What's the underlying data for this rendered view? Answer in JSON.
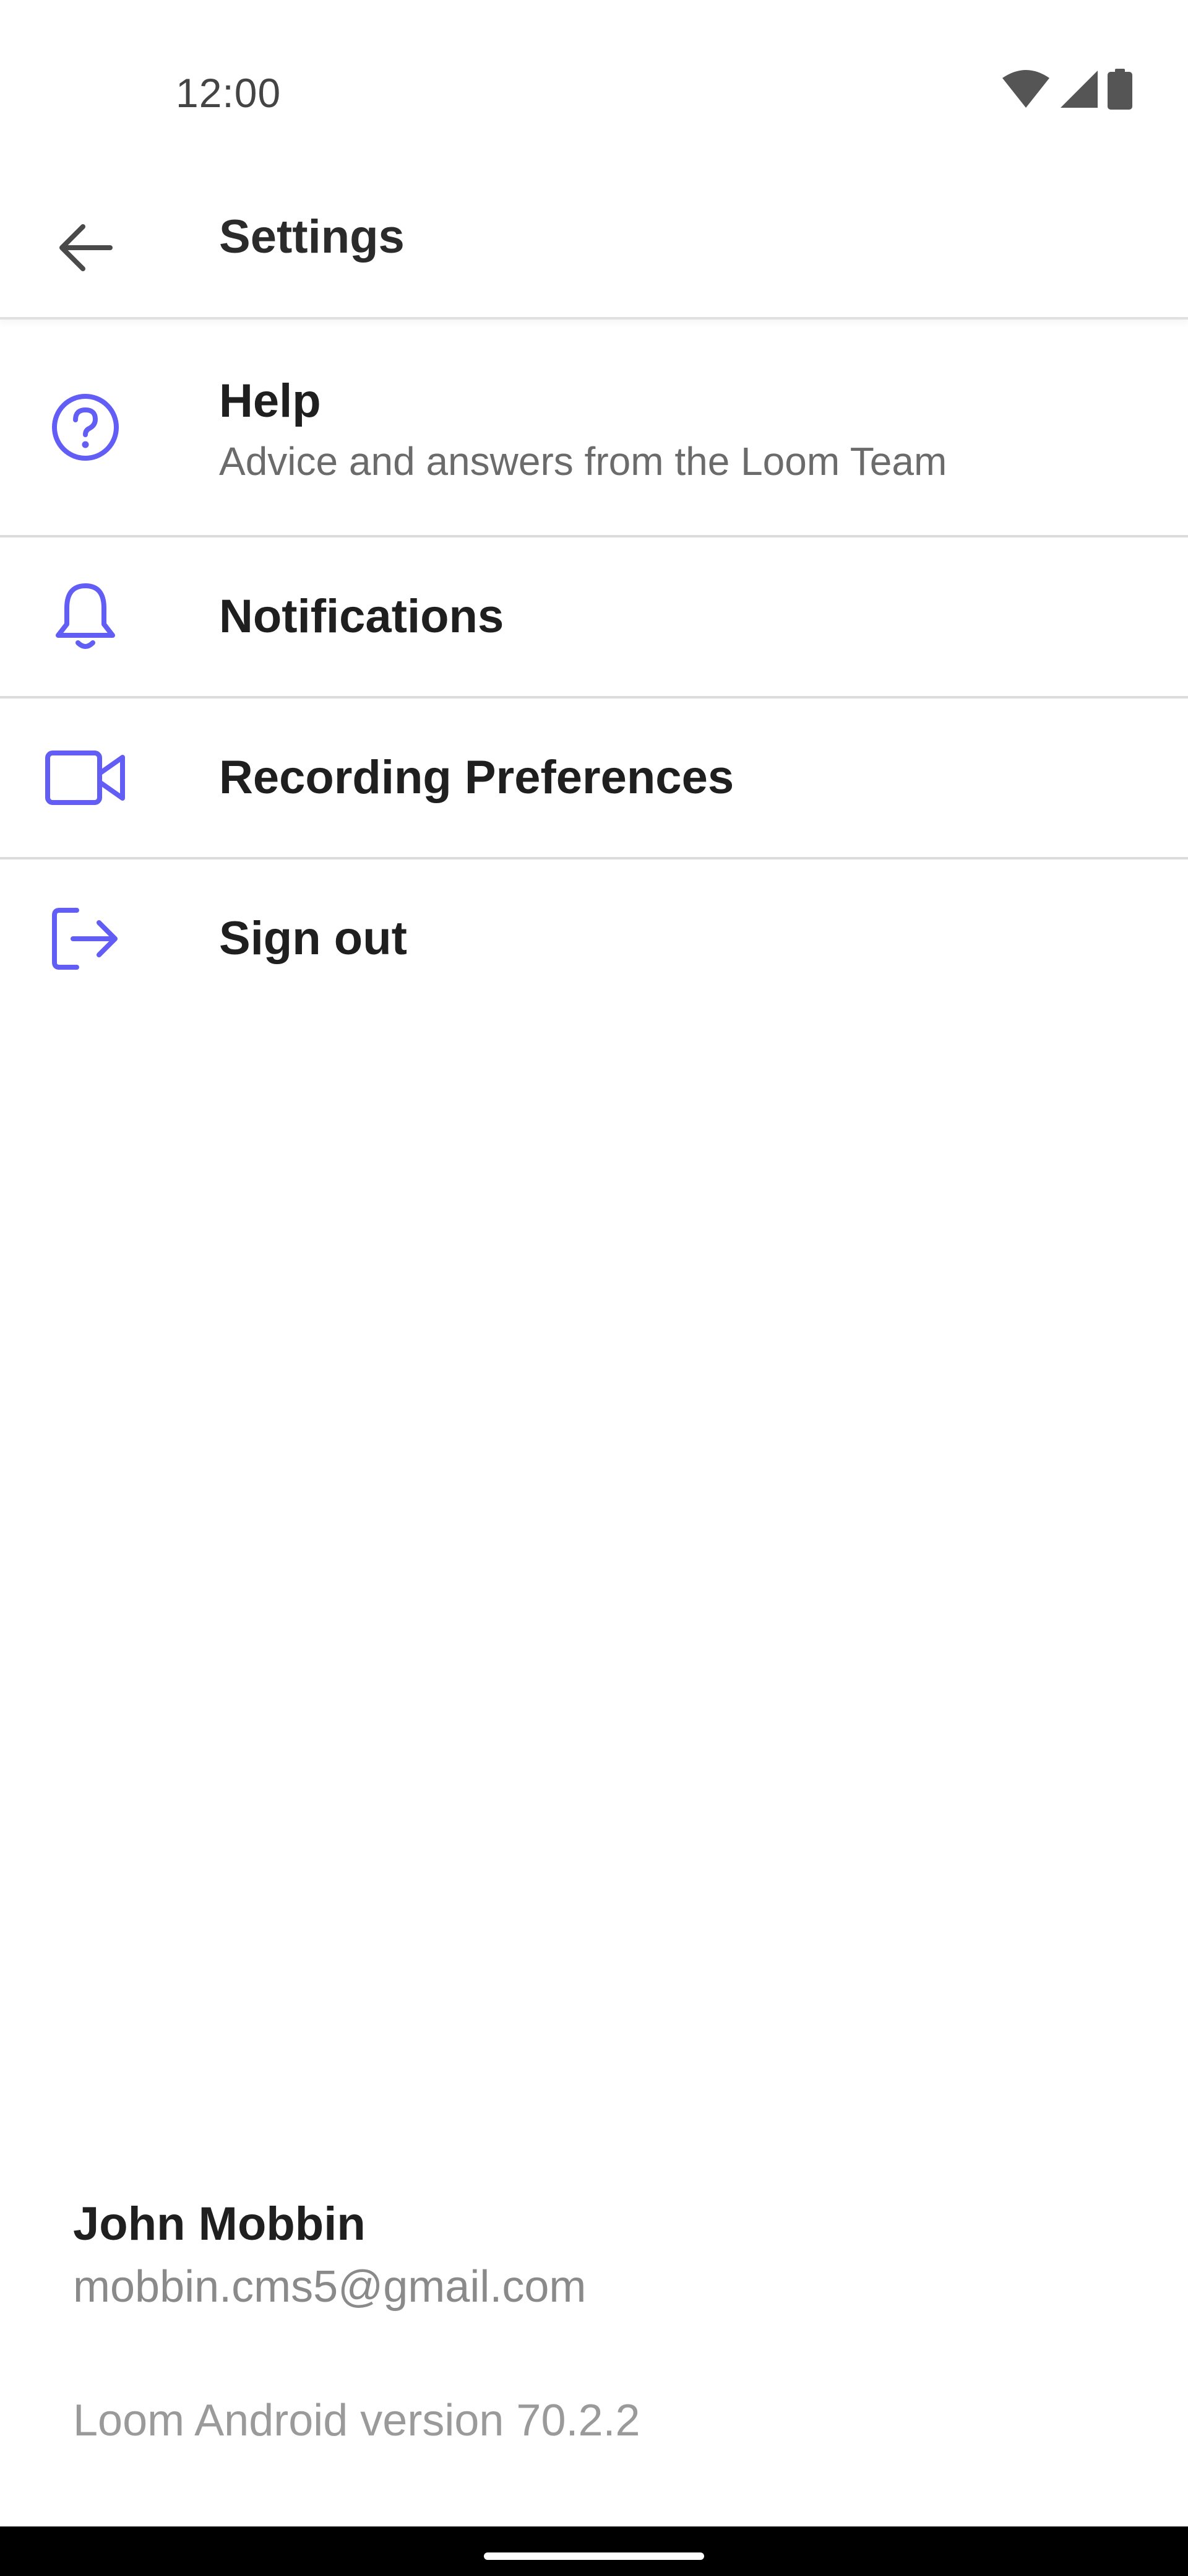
{
  "status_bar": {
    "time": "12:00",
    "icons": [
      "wifi-icon",
      "signal-icon",
      "battery-icon"
    ]
  },
  "app_bar": {
    "back_icon": "arrow-left-icon",
    "title": "Settings"
  },
  "settings": {
    "items": [
      {
        "icon": "help-circle-icon",
        "label": "Help",
        "sublabel": "Advice and answers from the Loom Team"
      },
      {
        "icon": "bell-icon",
        "label": "Notifications"
      },
      {
        "icon": "video-camera-icon",
        "label": "Recording Preferences"
      },
      {
        "icon": "sign-out-icon",
        "label": "Sign out"
      }
    ]
  },
  "account": {
    "name": "John Mobbin",
    "email": "mobbin.cms5@gmail.com",
    "version": "Loom Android version 70.2.2"
  },
  "colors": {
    "accent": "#625DF5",
    "divider": "#DCDCDC",
    "text_primary": "#1F1F1F",
    "text_secondary": "#6B6B6B"
  }
}
